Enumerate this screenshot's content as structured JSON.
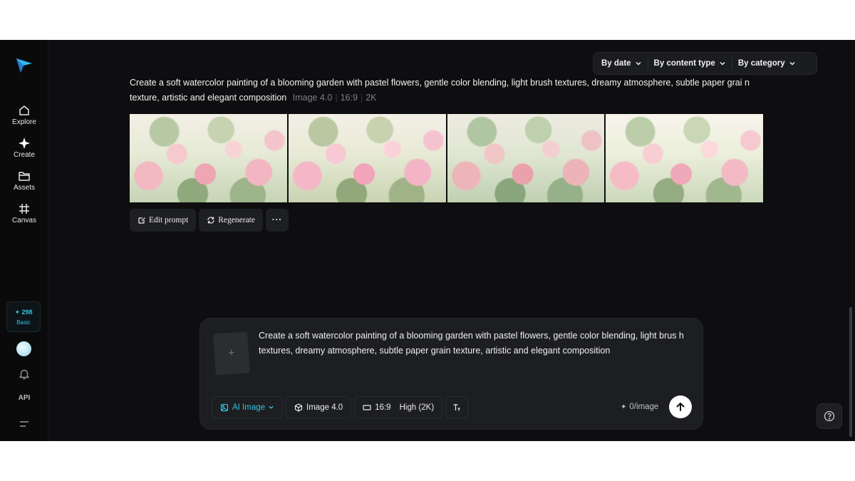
{
  "sidebar": {
    "items": [
      {
        "label": "Explore",
        "icon": "home-icon"
      },
      {
        "label": "Create",
        "icon": "sparkle-icon"
      },
      {
        "label": "Assets",
        "icon": "folder-icon"
      },
      {
        "label": "Canvas",
        "icon": "grid-icon"
      }
    ],
    "credits": {
      "value": "✦ 298",
      "plan": "Basic"
    },
    "api_label": "API"
  },
  "filters": {
    "by_date": "By date",
    "by_content_type": "By content type",
    "by_category": "By category"
  },
  "result": {
    "prompt": "Create a soft watercolor painting of a blooming garden with pastel flowers, gentle color blending, light brush textures, dreamy atmosphere, subtle paper grai n texture, artistic and elegant composition",
    "model": "Image 4.0",
    "ratio": "16:9",
    "resolution": "2K",
    "actions": {
      "edit_prompt": "Edit prompt",
      "regenerate": "Regenerate",
      "more": "···"
    }
  },
  "composer": {
    "upload_glyph": "+",
    "prompt": "Create a soft watercolor painting of a blooming garden with pastel flowers, gentle color blending, light brus h textures, dreamy atmosphere, subtle paper grain texture, artistic and elegant composition",
    "mode": "AI Image",
    "model": "Image 4.0",
    "ratio": "16:9",
    "quality": "High (2K)",
    "cost": "0/image",
    "cost_glyph": "✦"
  },
  "colors": {
    "accent": "#33c3e0",
    "background": "#0e0e10",
    "panel": "#1d1e21"
  }
}
